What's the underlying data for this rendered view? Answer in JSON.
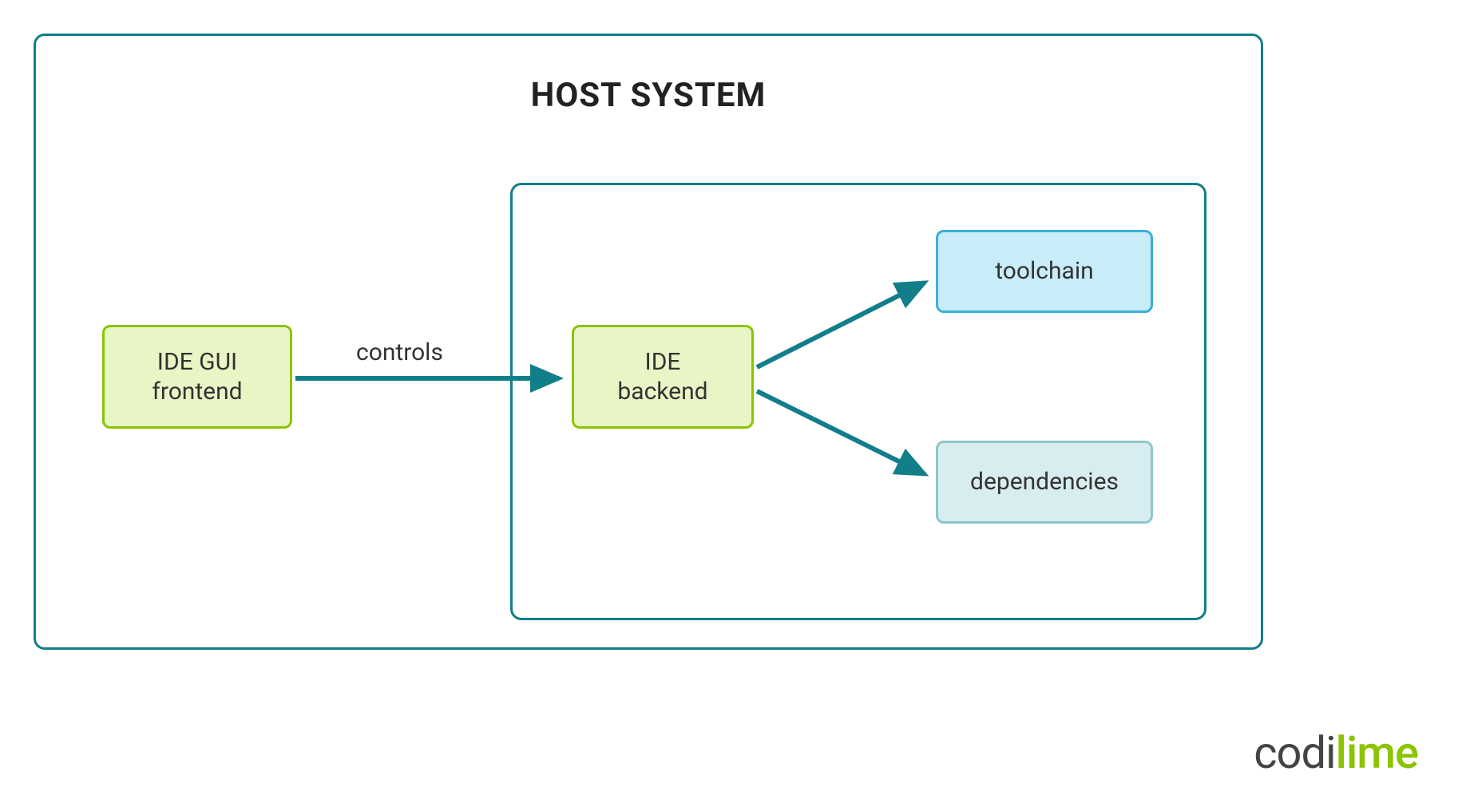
{
  "diagram": {
    "title": "HOST SYSTEM",
    "nodes": {
      "frontend": "IDE GUI\nfrontend",
      "backend": "IDE\nbackend",
      "toolchain": "toolchain",
      "dependencies": "dependencies"
    },
    "edges": {
      "controls": "controls"
    }
  },
  "brand": {
    "part1": "codi",
    "part2": "lime"
  },
  "colors": {
    "teal": "#127e8a",
    "green_border": "#8bc400",
    "green_fill": "#e8f6c6",
    "blue_border": "#3aaed8",
    "blue_fill": "#c8ecf8",
    "blue_light_border": "#8fc6cc",
    "blue_light_fill": "#d8edf0"
  }
}
